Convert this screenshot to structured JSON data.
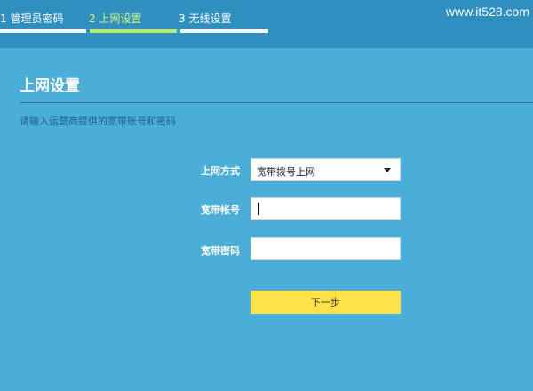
{
  "wizard": {
    "steps": [
      {
        "label": "1 管理员密码",
        "active": false
      },
      {
        "label": "2 上网设置",
        "active": true
      },
      {
        "label": "3 无线设置",
        "active": false
      }
    ]
  },
  "watermark": "www.it528.com",
  "page": {
    "title": "上网设置",
    "hint": "请输入运营商提供的宽带账号和密码"
  },
  "form": {
    "connection_type_label": "上网方式",
    "connection_type_value": "宽带拨号上网",
    "account_label": "宽带帐号",
    "account_value": "",
    "password_label": "宽带密码",
    "password_value": "",
    "next_button": "下一步"
  },
  "colors": {
    "background": "#4aaed9",
    "header": "#2f8fbf",
    "active_step": "#b7ec6c",
    "button": "#ffe24a"
  }
}
